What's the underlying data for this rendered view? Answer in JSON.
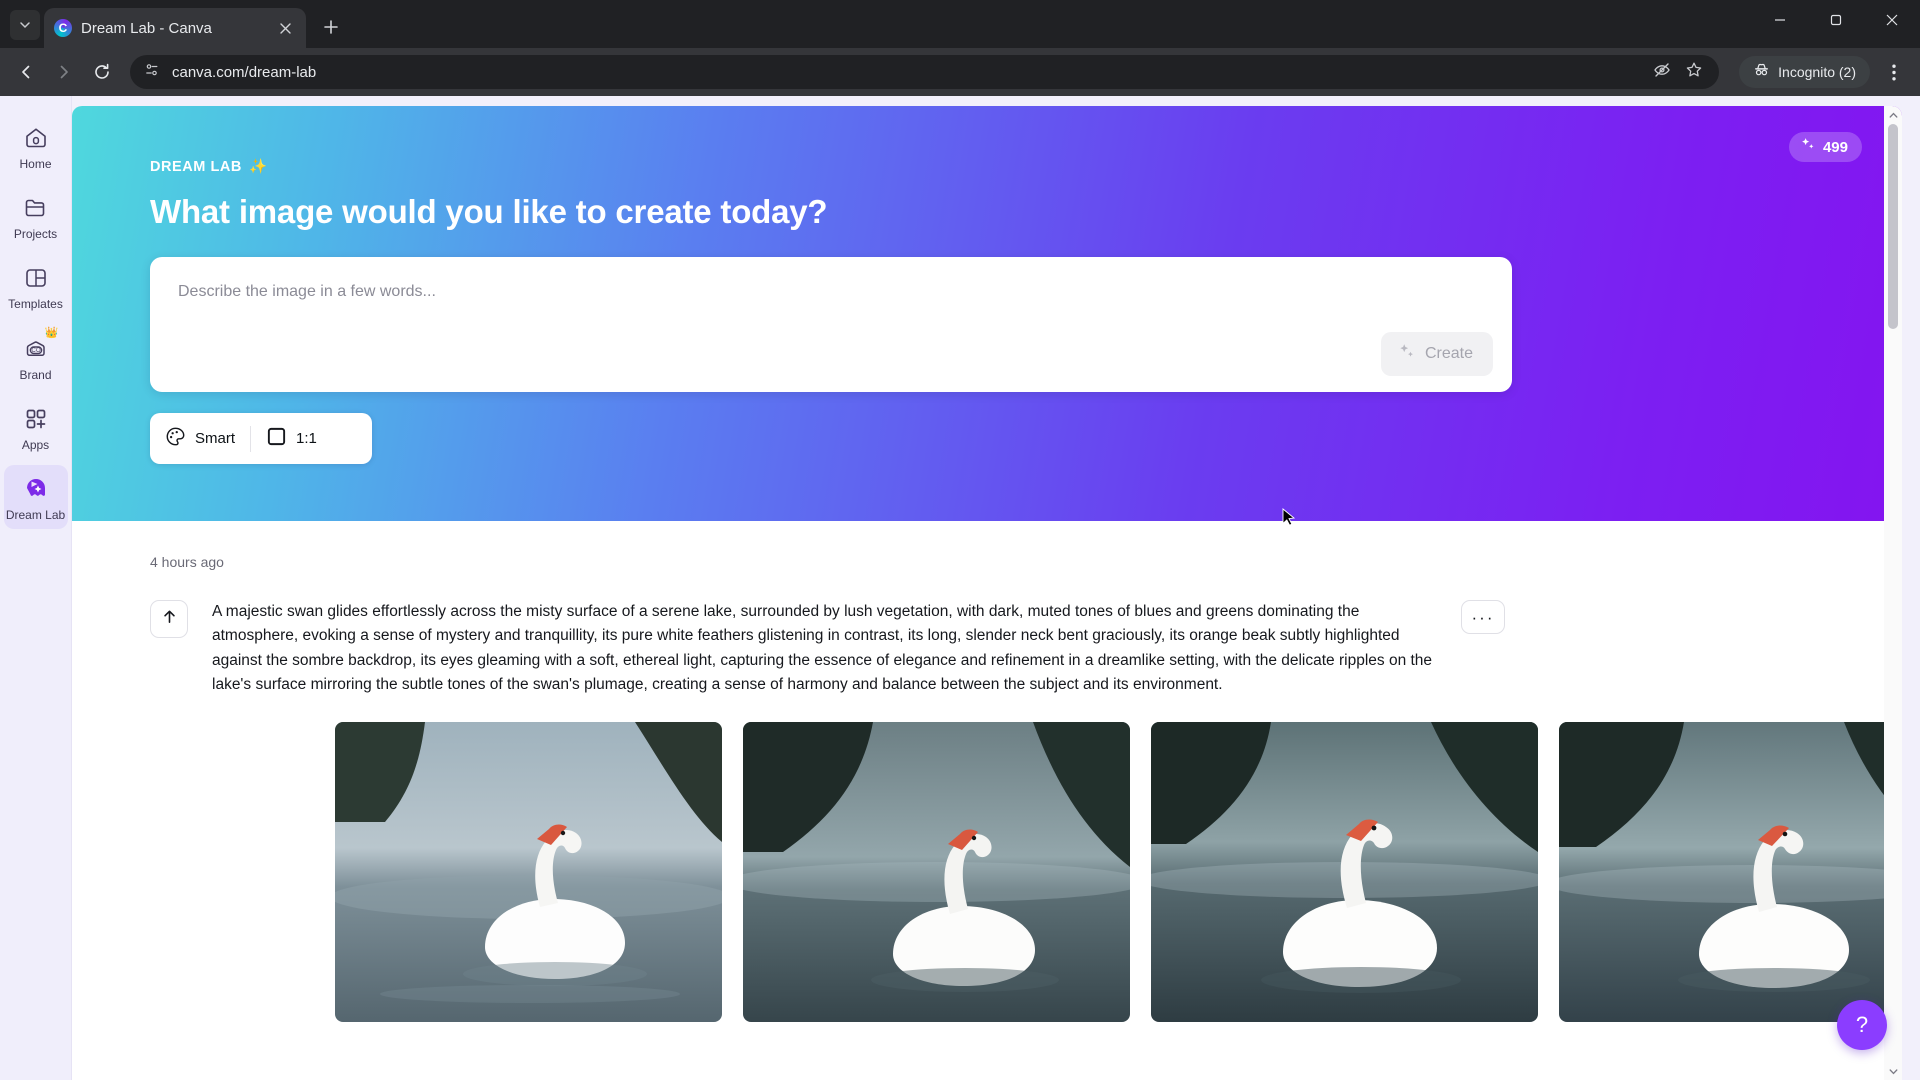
{
  "browser": {
    "tab": {
      "title": "Dream Lab - Canva",
      "favicon": "canva-logo-icon",
      "close": "×"
    },
    "new_tab_label": "+",
    "url": "canva.com/dream-lab",
    "incognito_label": "Incognito (2)",
    "window": {
      "minimize": "—",
      "maximize": "▢",
      "close": "✕"
    }
  },
  "sidebar": {
    "items": [
      {
        "label": "Home",
        "icon": "home-icon",
        "active": false
      },
      {
        "label": "Projects",
        "icon": "folder-icon",
        "active": false
      },
      {
        "label": "Templates",
        "icon": "templates-icon",
        "active": false
      },
      {
        "label": "Brand",
        "icon": "brand-kit-icon",
        "active": false,
        "badge": "crown-icon"
      },
      {
        "label": "Apps",
        "icon": "apps-grid-icon",
        "active": false
      },
      {
        "label": "Dream Lab",
        "icon": "dream-lab-icon",
        "active": true
      }
    ]
  },
  "hero": {
    "eyebrow": "DREAM LAB",
    "eyebrow_icon": "sparkles-icon",
    "title": "What image would you like to create today?",
    "credits": {
      "value": "499",
      "icon": "credits-sparkle-icon"
    },
    "gradient_from": "#4fd8dd",
    "gradient_to": "#8414f0"
  },
  "prompt": {
    "placeholder": "Describe the image in a few words...",
    "value": "",
    "create_label": "Create",
    "create_icon": "sparkles-icon"
  },
  "options": [
    {
      "label": "Smart",
      "icon": "palette-icon"
    },
    {
      "label": "1:1",
      "icon": "square-ratio-icon"
    }
  ],
  "results": {
    "timestamp": "4 hours ago",
    "up_icon": "arrow-up-icon",
    "more_label": "···",
    "prompt_text": "A majestic swan glides effortlessly across the misty surface of a serene lake, surrounded by lush vegetation, with dark, muted tones of blues and greens dominating the atmosphere, evoking a sense of mystery and tranquillity, its pure white feathers glistening in contrast, its long, slender neck bent graciously, its orange beak subtly highlighted against the sombre backdrop, its eyes gleaming with a soft, ethereal light, capturing the essence of elegance and refinement in a dreamlike setting, with the delicate ripples on the lake's surface mirroring the subtle tones of the swan's plumage, creating a sense of harmony and balance between the subject and its environment.",
    "images": [
      {
        "alt": "swan-image-1"
      },
      {
        "alt": "swan-image-2"
      },
      {
        "alt": "swan-image-3"
      },
      {
        "alt": "swan-image-4"
      }
    ]
  },
  "help": {
    "label": "?"
  },
  "accent": "#8b3dff"
}
